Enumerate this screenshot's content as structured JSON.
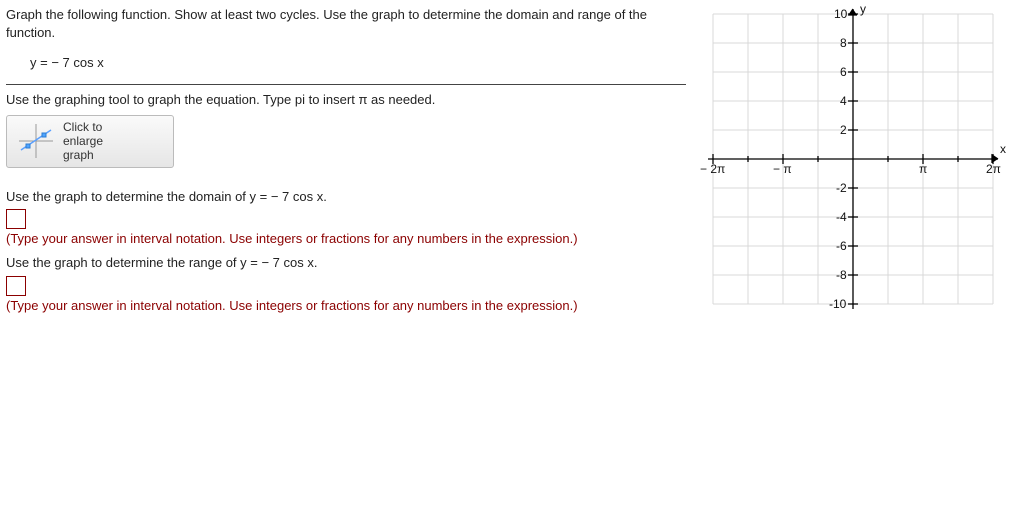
{
  "question": {
    "intro": "Graph the following function. Show at least two cycles. Use the graph to determine the domain and range of the function.",
    "equation": "y = − 7 cos x",
    "graph_hint": "Use the graphing tool to graph the equation. Type pi to insert π as needed.",
    "enlarge_label": "Click to\nenlarge\ngraph",
    "domain_prompt": "Use the graph to determine the domain of y = − 7 cos x.",
    "range_prompt": "Use the graph to determine the range of y = − 7 cos x.",
    "hint_text": "(Type your answer in interval notation. Use integers or fractions for any numbers in the expression.)"
  },
  "chart_data": {
    "type": "scatter",
    "title": "",
    "xlabel": "x",
    "ylabel": "y",
    "x_ticks": [
      "− 2π",
      "− π",
      "π",
      "2π"
    ],
    "y_ticks": [
      10,
      8,
      6,
      4,
      2,
      -2,
      -4,
      -6,
      -8,
      -10
    ],
    "xlim": [
      "-2π",
      "2π"
    ],
    "ylim": [
      -10,
      10
    ],
    "series": []
  }
}
